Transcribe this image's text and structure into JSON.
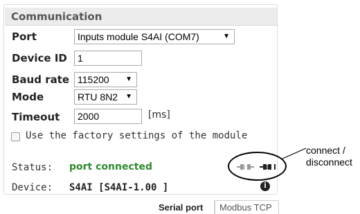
{
  "panel": {
    "title": "Communication"
  },
  "form": {
    "port": {
      "label": "Port",
      "value": "Inputs module S4AI (COM7)"
    },
    "device_id": {
      "label": "Device ID",
      "value": "1"
    },
    "baud_rate": {
      "label": "Baud rate",
      "value": "115200"
    },
    "mode": {
      "label": "Mode",
      "value": "RTU 8N2"
    },
    "timeout": {
      "label": "Timeout",
      "value": "2000",
      "unit": "[ms]"
    },
    "factory_settings": {
      "label": "Use the factory settings of the module",
      "checked": false
    }
  },
  "status": {
    "label": "Status:",
    "value": "port connected",
    "value_color": "#2f8a2f"
  },
  "device": {
    "label": "Device:",
    "value": "S4AI [S4AI-1.00 ]"
  },
  "icons": {
    "disconnect": "unplugged-icon",
    "connect": "plug-icon",
    "info": "info-icon"
  },
  "tabs": [
    {
      "label": "Serial port",
      "active": true
    },
    {
      "label": "Modbus TCP",
      "active": false
    }
  ],
  "annotation": {
    "line1": "connect /",
    "line2": "disconnect"
  }
}
